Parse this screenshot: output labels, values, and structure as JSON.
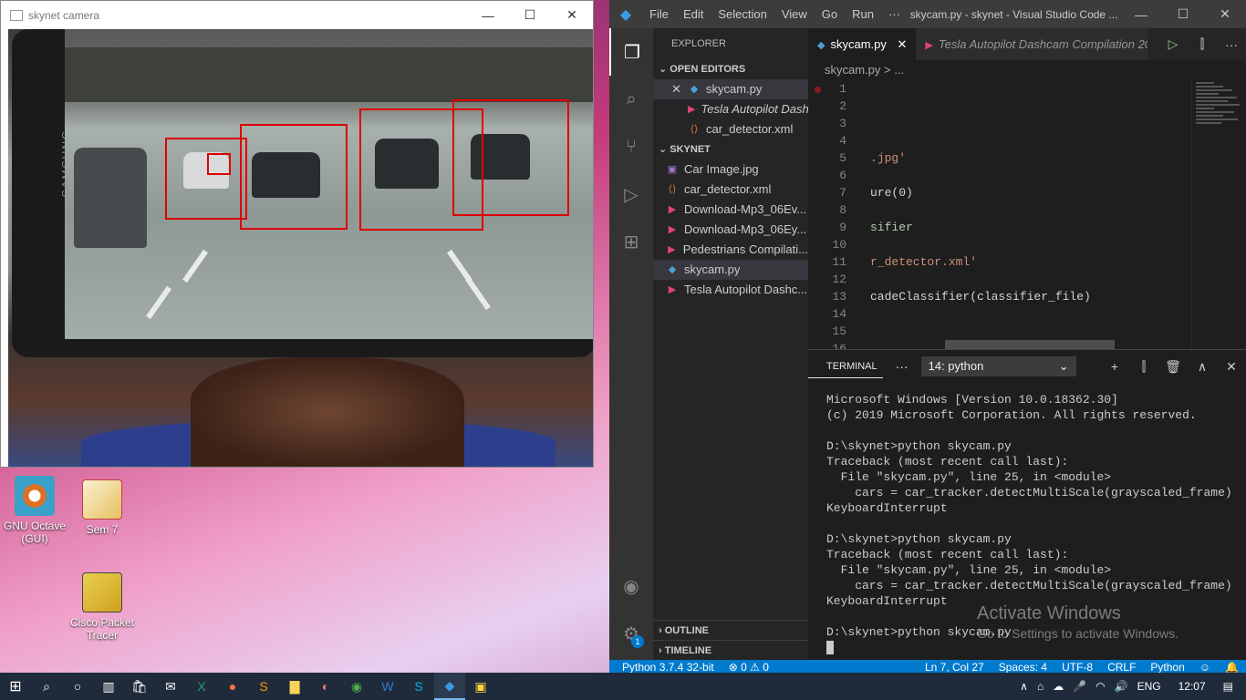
{
  "desktop": {
    "icons": [
      {
        "label": "GNU Octave (GUI)"
      },
      {
        "label": "Sem 7"
      },
      {
        "label": "Cisco Packet Tracer"
      }
    ]
  },
  "camera_window": {
    "title": "skynet camera",
    "minimize": "—",
    "maximize": "☐",
    "close": "✕",
    "phone_brand": "SAMSUNG"
  },
  "vscode": {
    "logo": "◆",
    "menu": [
      "File",
      "Edit",
      "Selection",
      "View",
      "Go",
      "Run",
      "···"
    ],
    "window_title": "skycam.py - skynet - Visual Studio Code ...",
    "window_controls": {
      "minimize": "—",
      "maximize": "☐",
      "close": "✕"
    },
    "activity_icons": [
      "files-icon",
      "search-icon",
      "source-control-icon",
      "run-debug-icon",
      "extensions-icon"
    ],
    "activity_badge": "1",
    "explorer": {
      "header": "EXPLORER",
      "open_editors_label": "OPEN EDITORS",
      "open_editors": [
        {
          "name": "skycam.py",
          "kind": "py",
          "close": "✕"
        },
        {
          "name": "Tesla Autopilot Dash...",
          "kind": "vid"
        },
        {
          "name": "car_detector.xml",
          "kind": "xml"
        }
      ],
      "folder_label": "SKYNET",
      "files": [
        {
          "name": "Car Image.jpg",
          "kind": "img"
        },
        {
          "name": "car_detector.xml",
          "kind": "xml"
        },
        {
          "name": "Download-Mp3_06Ev...",
          "kind": "vid"
        },
        {
          "name": "Download-Mp3_06Ey...",
          "kind": "vid"
        },
        {
          "name": "Pedestrians Compilati...",
          "kind": "vid"
        },
        {
          "name": "skycam.py",
          "kind": "py"
        },
        {
          "name": "Tesla Autopilot Dashc...",
          "kind": "vid"
        }
      ],
      "outline_label": "OUTLINE",
      "timeline_label": "TIMELINE"
    },
    "tabs": [
      {
        "label": "skycam.py",
        "close": "✕"
      },
      {
        "label": "Tesla Autopilot Dashcam Compilation 20"
      }
    ],
    "tab_actions": [
      "▷",
      "⫿",
      "···"
    ],
    "breadcrumb": "skycam.py > ...",
    "code_lines": [
      {
        "n": "1",
        "text": ""
      },
      {
        "n": "2",
        "text": ""
      },
      {
        "n": "3",
        "text": ""
      },
      {
        "n": "4",
        "text": ""
      },
      {
        "n": "5",
        "text": ".jpg'"
      },
      {
        "n": "6",
        "text": ""
      },
      {
        "n": "7",
        "text": "ure(0)"
      },
      {
        "n": "8",
        "text": ""
      },
      {
        "n": "9",
        "text": "sifier"
      },
      {
        "n": "10",
        "text": ""
      },
      {
        "n": "11",
        "text": "r_detector.xml'"
      },
      {
        "n": "12",
        "text": ""
      },
      {
        "n": "13",
        "text": "cadeClassifier(classifier_file)"
      },
      {
        "n": "14",
        "text": ""
      },
      {
        "n": "15",
        "text": ""
      },
      {
        "n": "16",
        "text": ""
      }
    ],
    "panel": {
      "tab": "TERMINAL",
      "more": "···",
      "terminal_select": "14: python",
      "actions": [
        "+",
        "⫿",
        "🗑",
        "∧",
        "✕"
      ]
    },
    "terminal_lines": [
      "Microsoft Windows [Version 10.0.18362.30]",
      "(c) 2019 Microsoft Corporation. All rights reserved.",
      "",
      "D:\\skynet>python skycam.py",
      "Traceback (most recent call last):",
      "  File \"skycam.py\", line 25, in <module>",
      "    cars = car_tracker.detectMultiScale(grayscaled_frame)",
      "KeyboardInterrupt",
      "",
      "D:\\skynet>python skycam.py",
      "Traceback (most recent call last):",
      "  File \"skycam.py\", line 25, in <module>",
      "    cars = car_tracker.detectMultiScale(grayscaled_frame)",
      "KeyboardInterrupt",
      "",
      "D:\\skynet>python skycam.py"
    ],
    "activate": {
      "line1": "Activate Windows",
      "line2": "Go to Settings to activate Windows."
    },
    "status": {
      "python": "Python 3.7.4 32-bit",
      "problems": "⊗ 0 ⚠ 0",
      "position": "Ln 7, Col 27",
      "spaces": "Spaces: 4",
      "encoding": "UTF-8",
      "eol": "CRLF",
      "language": "Python",
      "feedback": "☺",
      "bell": "🔔"
    }
  },
  "taskbar": {
    "start": "⊞",
    "search": "⌕",
    "cortana": "○",
    "apps": [
      "task-view",
      "store",
      "mail",
      "excel",
      "firefox",
      "sublime",
      "explorer",
      "paint",
      "chrome",
      "word",
      "skype",
      "vscode",
      "python"
    ],
    "tray": {
      "chevron": "∧",
      "lang": "ENG",
      "time": "12:07"
    }
  },
  "colors": {
    "vscode_accent": "#007acc",
    "detection_box": "#e00000"
  }
}
